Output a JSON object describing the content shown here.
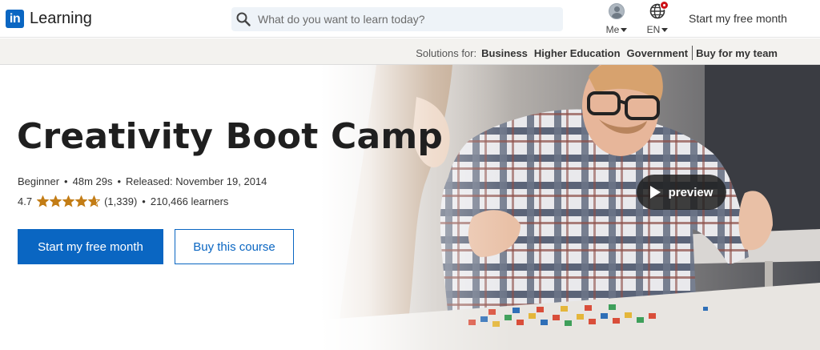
{
  "header": {
    "logo_mark": "in",
    "logo_text": "Learning",
    "search_placeholder": "What do you want to learn today?",
    "me_label": "Me",
    "lang_label": "EN",
    "cta_label": "Start my free month"
  },
  "solutions": {
    "prefix": "Solutions for:",
    "links": [
      "Business",
      "Higher Education",
      "Government"
    ],
    "team_link": "Buy for my team"
  },
  "course": {
    "title": "Creativity Boot Camp",
    "level": "Beginner",
    "duration": "48m 29s",
    "released": "Released: November 19, 2014",
    "rating": "4.7",
    "rating_value": 4.7,
    "rating_max": 5,
    "review_count": "(1,339)",
    "learners": "210,466 learners",
    "primary_button": "Start my free month",
    "secondary_button": "Buy this course",
    "preview_label": "preview"
  },
  "colors": {
    "brand": "#0a66c2",
    "star": "#c37d16",
    "notification": "#cc1016"
  }
}
